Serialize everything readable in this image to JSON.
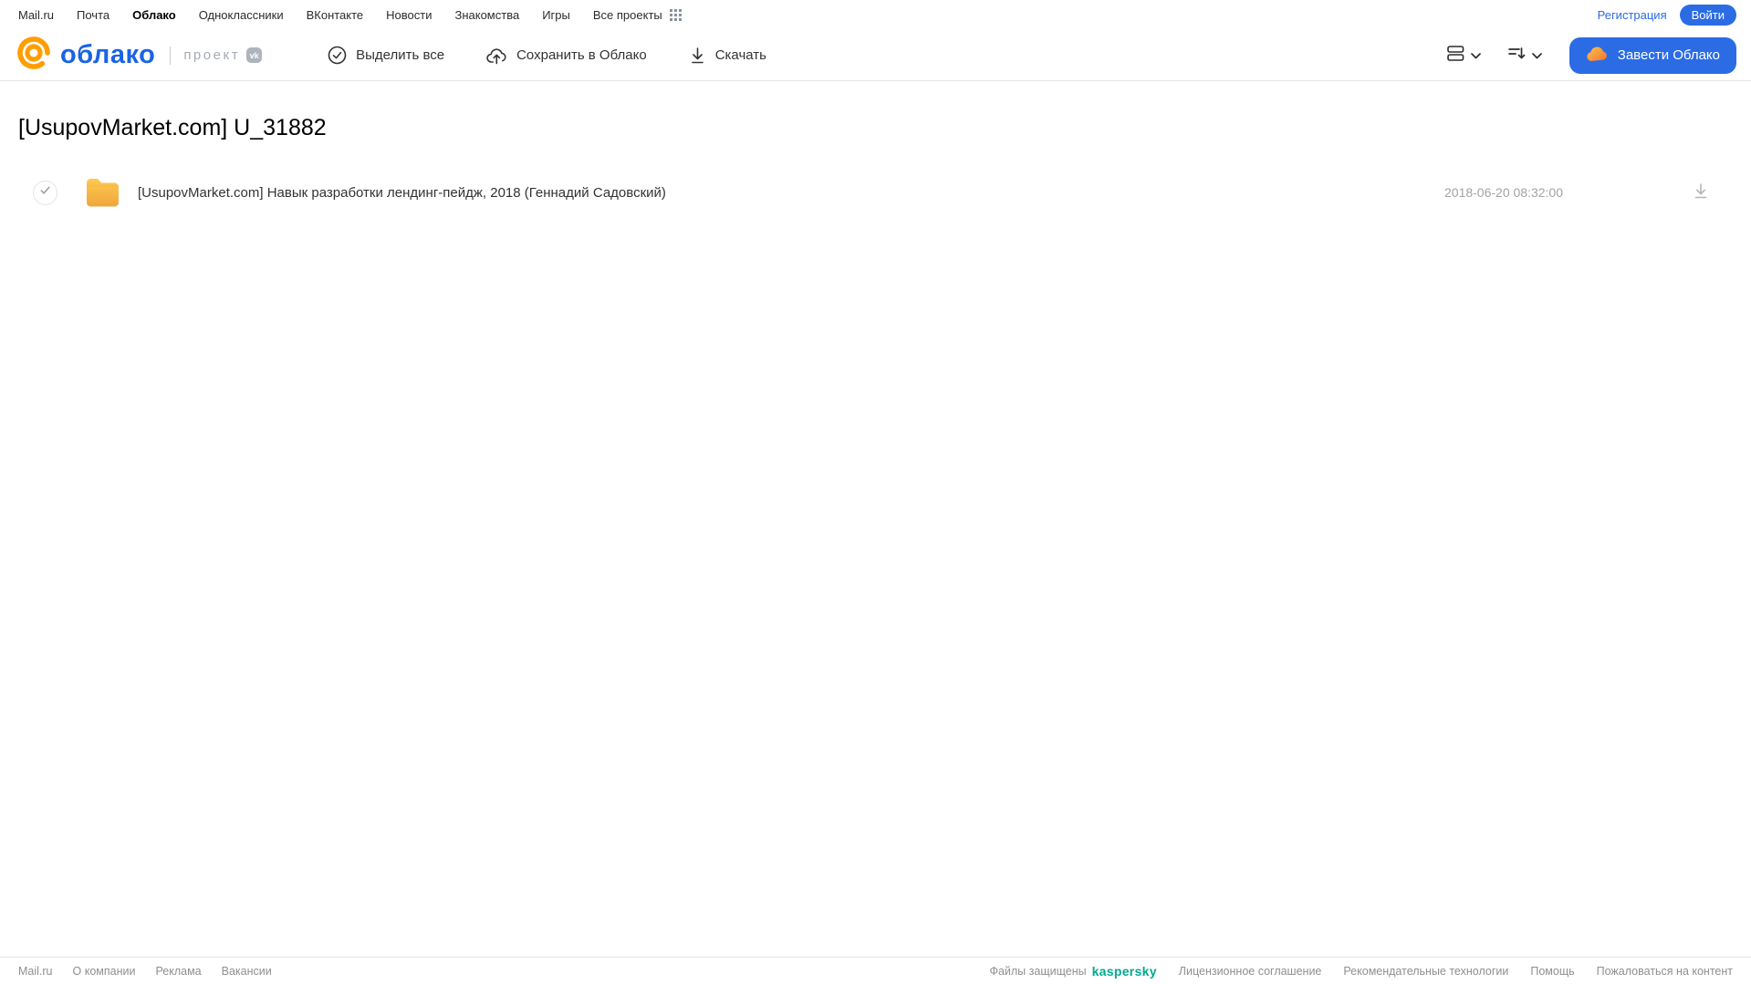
{
  "topnav": {
    "items": [
      {
        "label": "Mail.ru",
        "active": false
      },
      {
        "label": "Почта",
        "active": false
      },
      {
        "label": "Облако",
        "active": true
      },
      {
        "label": "Одноклассники",
        "active": false
      },
      {
        "label": "ВКонтакте",
        "active": false
      },
      {
        "label": "Новости",
        "active": false
      },
      {
        "label": "Знакомства",
        "active": false
      },
      {
        "label": "Игры",
        "active": false
      },
      {
        "label": "Все проекты",
        "active": false
      }
    ],
    "registration_label": "Регистрация",
    "login_label": "Войти"
  },
  "header": {
    "logo_text": "облако",
    "project_label": "проект",
    "vk_badge_label": "vk",
    "toolbar": {
      "select_all_label": "Выделить все",
      "save_to_cloud_label": "Сохранить в Облако",
      "download_label": "Скачать"
    },
    "get_cloud_button_label": "Завести Облако"
  },
  "main": {
    "title": "[UsupovMarket.com] U_31882",
    "files": [
      {
        "type": "folder",
        "name": "[UsupovMarket.com] Навык разработки лендинг-пейдж, 2018 (Геннадий Садовский)",
        "date": "2018-06-20 08:32:00"
      }
    ]
  },
  "footer": {
    "left_links": [
      {
        "label": "Mail.ru"
      },
      {
        "label": "О компании"
      },
      {
        "label": "Реклама"
      },
      {
        "label": "Вакансии"
      }
    ],
    "protected_by_label": "Файлы защищены",
    "kaspersky_label": "kaspersky",
    "right_links": [
      {
        "label": "Лицензионное соглашение"
      },
      {
        "label": "Рекомендательные технологии"
      },
      {
        "label": "Помощь"
      },
      {
        "label": "Пожаловаться на контент"
      }
    ]
  },
  "icons": {
    "at-logo-icon": "@",
    "apps-grid-icon": "⠿",
    "check-circle-icon": "✓",
    "cloud-upload-icon": "☁↑",
    "download-icon": "⤓",
    "view-mode-icon": "▤",
    "sort-icon": "≡↓",
    "chevron-down-icon": "⌄",
    "cloud-icon": "☁",
    "folder-icon": "📁",
    "checkbox-check-icon": "✓"
  },
  "colors": {
    "accent_blue": "#2b6ce5",
    "logo_blue": "#1b63e4",
    "logo_orange": "#ff9e00",
    "folder_top": "#ffc94f",
    "folder_bottom": "#efa63c",
    "kaspersky_teal": "#00a88e",
    "text_dark": "#333333",
    "text_gray": "#a3a3a3",
    "border_gray": "#e7e7e7"
  }
}
